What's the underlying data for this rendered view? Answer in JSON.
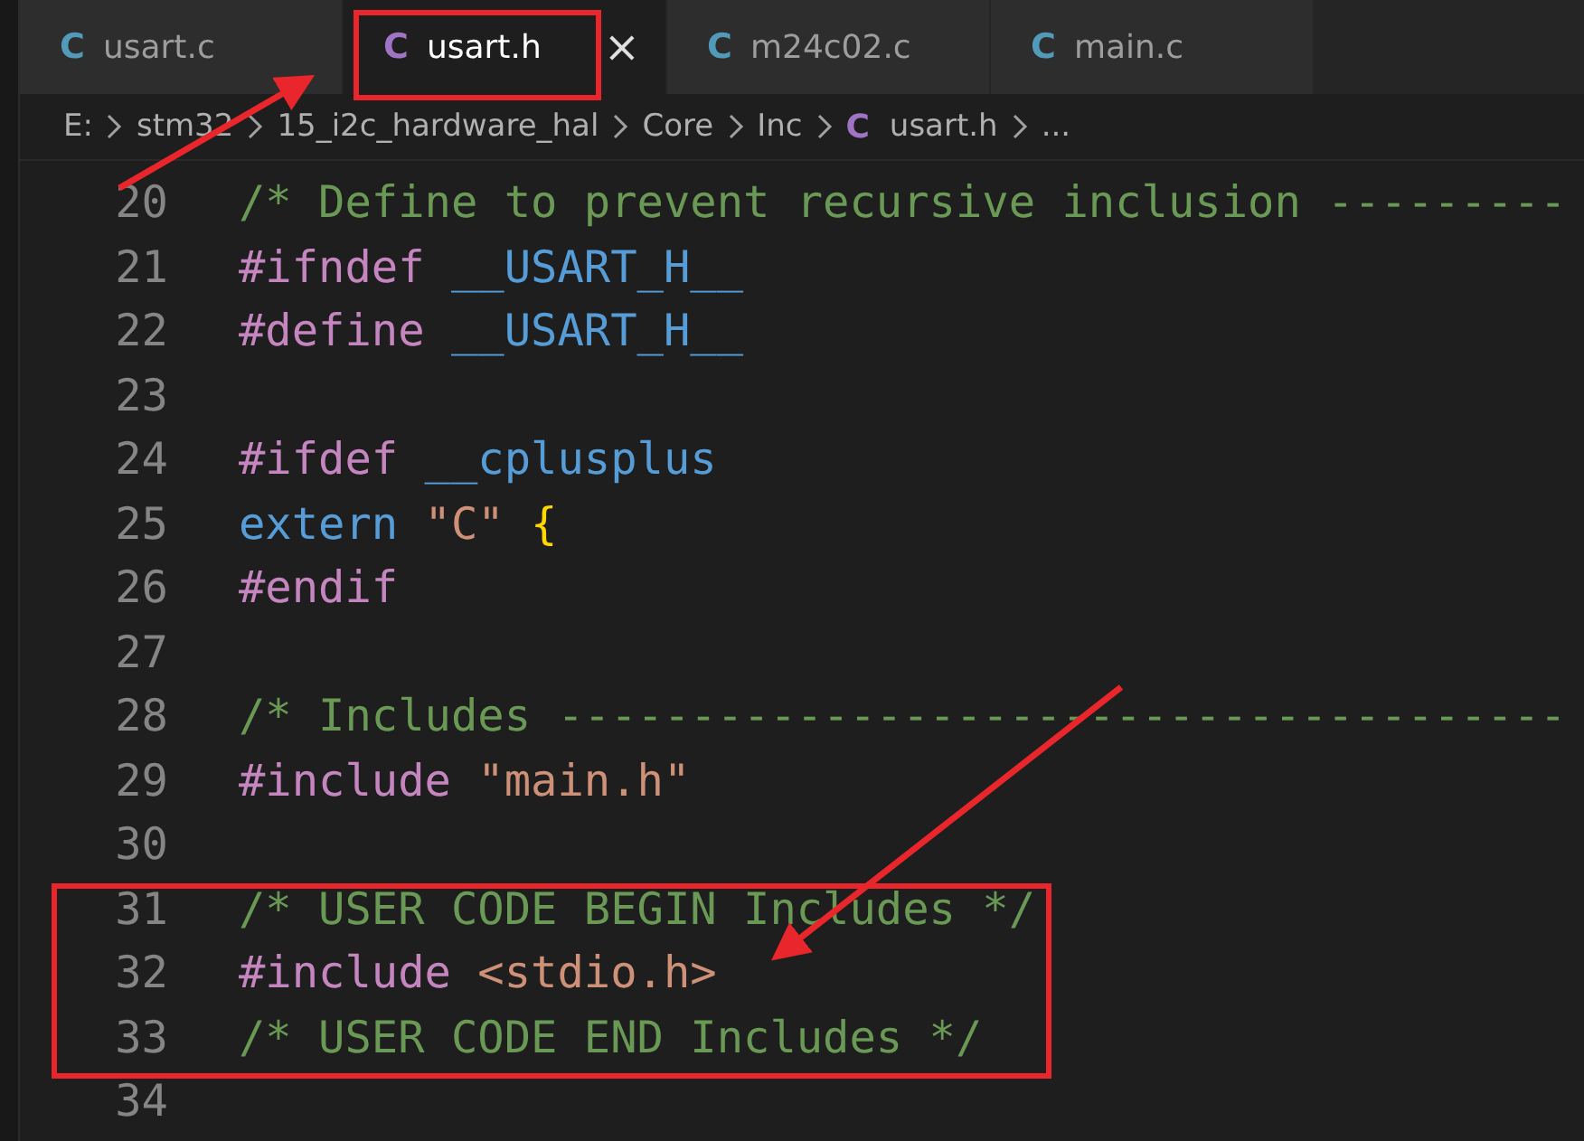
{
  "tabs": [
    {
      "icon": "C",
      "color": "#519aba",
      "label": "usart.c",
      "selected": false
    },
    {
      "icon": "C",
      "color": "#a074c4",
      "label": "usart.h",
      "selected": true,
      "close": "×"
    },
    {
      "icon": "C",
      "color": "#519aba",
      "label": "m24c02.c",
      "selected": false
    },
    {
      "icon": "C",
      "color": "#519aba",
      "label": "main.c",
      "selected": false
    }
  ],
  "breadcrumbs": [
    {
      "label": "E:"
    },
    {
      "label": "stm32"
    },
    {
      "label": "15_i2c_hardware_hal"
    },
    {
      "label": "Core"
    },
    {
      "label": "Inc"
    },
    {
      "icon": "C",
      "color": "#a074c4",
      "label": "usart.h"
    },
    {
      "label": "..."
    }
  ],
  "code_lines": [
    {
      "number": "20",
      "tokens": [
        {
          "kind": "comment",
          "text": "/* Define to prevent recursive inclusion ---------"
        }
      ]
    },
    {
      "number": "21",
      "tokens": [
        {
          "kind": "directive",
          "text": "#ifndef "
        },
        {
          "kind": "macro",
          "text": "__USART_H__"
        }
      ]
    },
    {
      "number": "22",
      "tokens": [
        {
          "kind": "directive",
          "text": "#define "
        },
        {
          "kind": "macro",
          "text": "__USART_H__"
        }
      ]
    },
    {
      "number": "23"
    },
    {
      "number": "24",
      "tokens": [
        {
          "kind": "directive",
          "text": "#ifdef "
        },
        {
          "kind": "macro",
          "text": "__cplusplus"
        }
      ]
    },
    {
      "number": "25",
      "tokens": [
        {
          "kind": "macro",
          "text": "extern "
        },
        {
          "kind": "string",
          "text": "\"C\" "
        },
        {
          "kind": "brace",
          "text": "{"
        }
      ]
    },
    {
      "number": "26",
      "tokens": [
        {
          "kind": "directive",
          "text": "#endif"
        }
      ]
    },
    {
      "number": "27"
    },
    {
      "number": "28",
      "tokens": [
        {
          "kind": "comment",
          "text": "/* Includes --------------------------------------"
        }
      ]
    },
    {
      "number": "29",
      "tokens": [
        {
          "kind": "directive",
          "text": "#include "
        },
        {
          "kind": "string",
          "text": "\"main.h\""
        }
      ]
    },
    {
      "number": "30"
    },
    {
      "number": "31",
      "tokens": [
        {
          "kind": "comment",
          "text": "/* USER CODE BEGIN Includes */"
        }
      ]
    },
    {
      "number": "32",
      "tokens": [
        {
          "kind": "directive",
          "text": "#include "
        },
        {
          "kind": "string",
          "text": "<stdio.h>"
        }
      ]
    },
    {
      "number": "33",
      "tokens": [
        {
          "kind": "comment",
          "text": "/* USER CODE END Includes */"
        }
      ]
    },
    {
      "number": "34"
    }
  ]
}
